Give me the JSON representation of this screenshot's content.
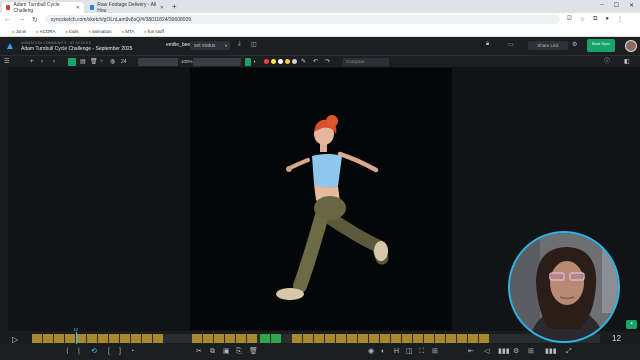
{
  "browser": {
    "tabs": [
      {
        "title": "Adam Turnbull Cycle Challeng",
        "active": true,
        "color": "#d93b3b"
      },
      {
        "title": "Raw Footage Delivery - All Hou",
        "active": false,
        "color": "#2a7de1"
      }
    ],
    "new_tab": "+",
    "url": "syncsketch.com/sketch/gOLnLam9v8sQ/#/38011824/39608939",
    "bookmarks": [
      "Junis",
      "ACORA",
      "tools",
      "animation",
      "MTA",
      "fun stuff"
    ]
  },
  "app": {
    "community_label": "ANIMATION COMMUNITY · AT ACCESS",
    "project_title": "Adam Turnbull Cycle Challenge - September 2025",
    "file_name": "emilie_beers.mp4",
    "status_label": "set status",
    "share_label": "Share Link",
    "start_sync_label": "Start Sync"
  },
  "toolbar": {
    "fps": "24",
    "zoom": "100%",
    "compare_placeholder": "Compare",
    "colors": [
      "#ff3b3b",
      "#ffe14a",
      "#ffffff",
      "#ffc83a",
      "#d0d0d0"
    ],
    "accent": "#18a36a"
  },
  "timeline": {
    "playhead_frame": "12",
    "current_frame": "12"
  }
}
